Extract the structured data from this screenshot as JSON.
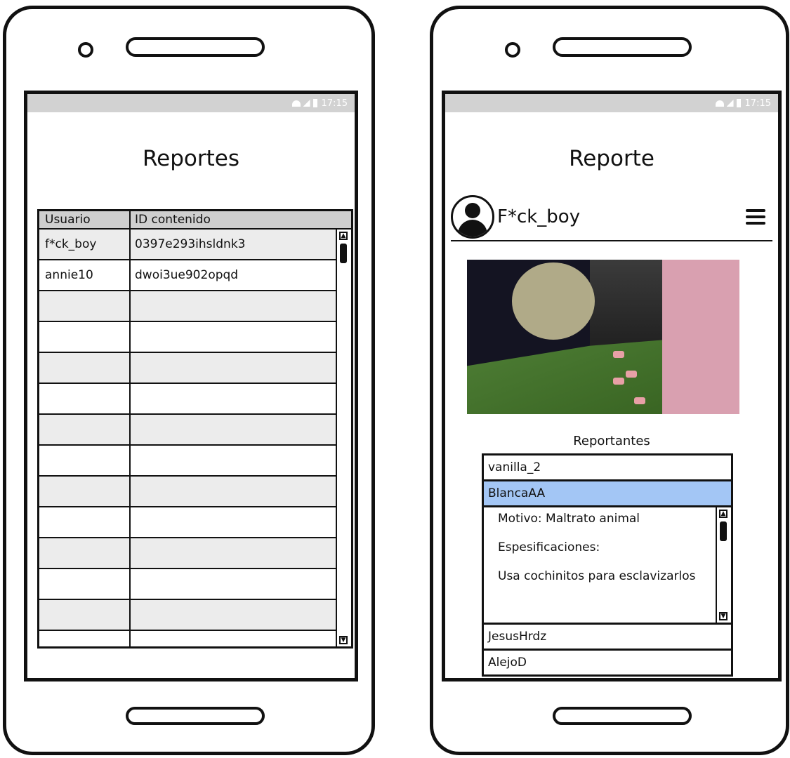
{
  "status_bar": {
    "time": "17:15"
  },
  "list_screen": {
    "title": "Reportes",
    "table": {
      "headers": [
        "Usuario",
        "ID contenido"
      ],
      "rows": [
        {
          "user": "f*ck_boy",
          "content_id": "0397e293ihsldnk3"
        },
        {
          "user": "annie10",
          "content_id": "dwoi3ue902opqd"
        },
        {
          "user": "",
          "content_id": ""
        },
        {
          "user": "",
          "content_id": ""
        },
        {
          "user": "",
          "content_id": ""
        },
        {
          "user": "",
          "content_id": ""
        },
        {
          "user": "",
          "content_id": ""
        },
        {
          "user": "",
          "content_id": ""
        },
        {
          "user": "",
          "content_id": ""
        },
        {
          "user": "",
          "content_id": ""
        },
        {
          "user": "",
          "content_id": ""
        },
        {
          "user": "",
          "content_id": ""
        },
        {
          "user": "",
          "content_id": ""
        },
        {
          "user": "",
          "content_id": ""
        }
      ]
    }
  },
  "detail_screen": {
    "title": "Reporte",
    "profile_name": "F*ck_boy",
    "reporters_label": "Reportantes",
    "reporters": [
      {
        "name": "vanilla_2",
        "selected": false
      },
      {
        "name": "BlancaAA",
        "selected": true
      },
      {
        "name": "JesusHrdz",
        "selected": false
      },
      {
        "name": "AlejoD",
        "selected": false
      }
    ],
    "selected_detail": {
      "motive": "Motivo: Maltrato animal",
      "specs_label": "Espesificaciones:",
      "specs_text": "Usa cochinitos para esclavizarlos"
    }
  },
  "colors": {
    "status_bar": "#d2d2d2",
    "header_row": "#cfcfcf",
    "alt_row": "#ececec",
    "selected_item": "#a3c6f5"
  }
}
